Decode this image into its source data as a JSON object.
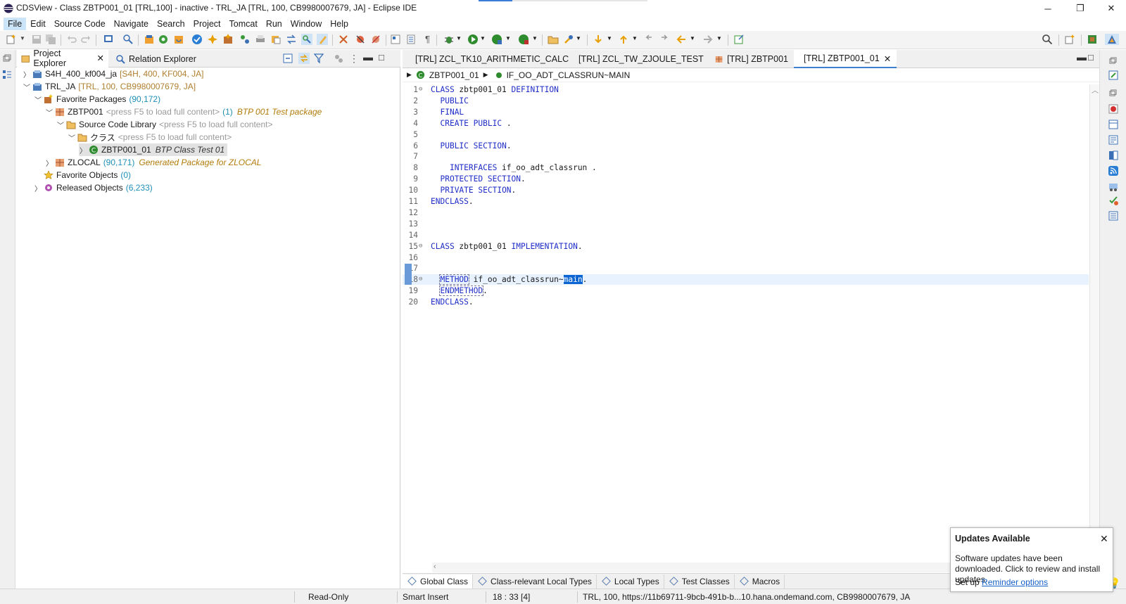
{
  "window": {
    "title": "CDSView - Class ZBTP001_01 [TRL,100] - inactive - TRL_JA [TRL, 100, CB9980007679, JA] - Eclipse IDE",
    "minimize": "─",
    "restore": "❐",
    "close": "✕"
  },
  "menu": [
    "File",
    "Edit",
    "Source Code",
    "Navigate",
    "Search",
    "Project",
    "Tomcat",
    "Run",
    "Window",
    "Help"
  ],
  "left_panel": {
    "tabs": [
      {
        "label": "Project Explorer",
        "close": "✕"
      },
      {
        "label": "Relation Explorer"
      }
    ],
    "tree": [
      {
        "text": "S4H_400_kf004_ja",
        "dim": "[S4H, 400, KF004, JA]"
      },
      {
        "text": "TRL_JA",
        "dim": "[TRL, 100, CB9980007679, JA]"
      },
      {
        "text": "Favorite Packages",
        "count": "(90,172)"
      },
      {
        "text": "ZBTP001",
        "dim": "<press F5 to load full content>",
        "count": "(1)",
        "desc": "BTP 001 Test package"
      },
      {
        "text": "Source Code Library",
        "dim": "<press F5 to load full content>"
      },
      {
        "text": "クラス",
        "dim": "<press F5 to load full content>"
      },
      {
        "text": "ZBTP001_01",
        "desc": "BTP Class Test 01"
      },
      {
        "text": "ZLOCAL",
        "count": "(90,171)",
        "desc": "Generated Package for ZLOCAL"
      },
      {
        "text": "Favorite Objects",
        "count": "(0)"
      },
      {
        "text": "Released Objects",
        "count": "(6,233)"
      }
    ]
  },
  "editor": {
    "tabs": [
      {
        "label": "[TRL] ZCL_TK10_ARITHMETIC_CALC"
      },
      {
        "label": "[TRL] ZCL_TW_ZJOULE_TEST"
      },
      {
        "label": "[TRL] ZBTP001"
      },
      {
        "label": "[TRL] ZBTP001_01",
        "close": "✕"
      }
    ],
    "breadcrumb": [
      "ZBTP001_01",
      "IF_OO_ADT_CLASSRUN~MAIN"
    ],
    "lines": [
      {
        "n": "1",
        "t": "CLASS zbtp001_01 DEFINITION"
      },
      {
        "n": "2",
        "t": "  PUBLIC"
      },
      {
        "n": "3",
        "t": "  FINAL"
      },
      {
        "n": "4",
        "t": "  CREATE PUBLIC ."
      },
      {
        "n": "5",
        "t": ""
      },
      {
        "n": "6",
        "t": "  PUBLIC SECTION."
      },
      {
        "n": "7",
        "t": ""
      },
      {
        "n": "8",
        "t": "    INTERFACES if_oo_adt_classrun ."
      },
      {
        "n": "9",
        "t": "  PROTECTED SECTION."
      },
      {
        "n": "10",
        "t": "  PRIVATE SECTION."
      },
      {
        "n": "11",
        "t": "ENDCLASS."
      },
      {
        "n": "12",
        "t": ""
      },
      {
        "n": "13",
        "t": ""
      },
      {
        "n": "14",
        "t": ""
      },
      {
        "n": "15",
        "t": "CLASS zbtp001_01 IMPLEMENTATION."
      },
      {
        "n": "16",
        "t": ""
      },
      {
        "n": "17",
        "t": ""
      },
      {
        "n": "18",
        "t": "  METHOD if_oo_adt_classrun~main."
      },
      {
        "n": "19",
        "t": "  ENDMETHOD."
      },
      {
        "n": "20",
        "t": "ENDCLASS."
      }
    ],
    "bottom_tabs": [
      "Global Class",
      "Class-relevant Local Types",
      "Local Types",
      "Test Classes",
      "Macros"
    ]
  },
  "status": {
    "readonly": "Read-Only",
    "insert": "Smart Insert",
    "position": "18 : 33 [4]",
    "system": "TRL, 100, https://11b69711-9bcb-491b-b...10.hana.ondemand.com, CB9980007679, JA"
  },
  "notification": {
    "title": "Updates Available",
    "close": "✕",
    "body": "Software updates have been downloaded. Click to review and install updates.",
    "prefix": "Set up",
    "link": "Reminder options"
  }
}
